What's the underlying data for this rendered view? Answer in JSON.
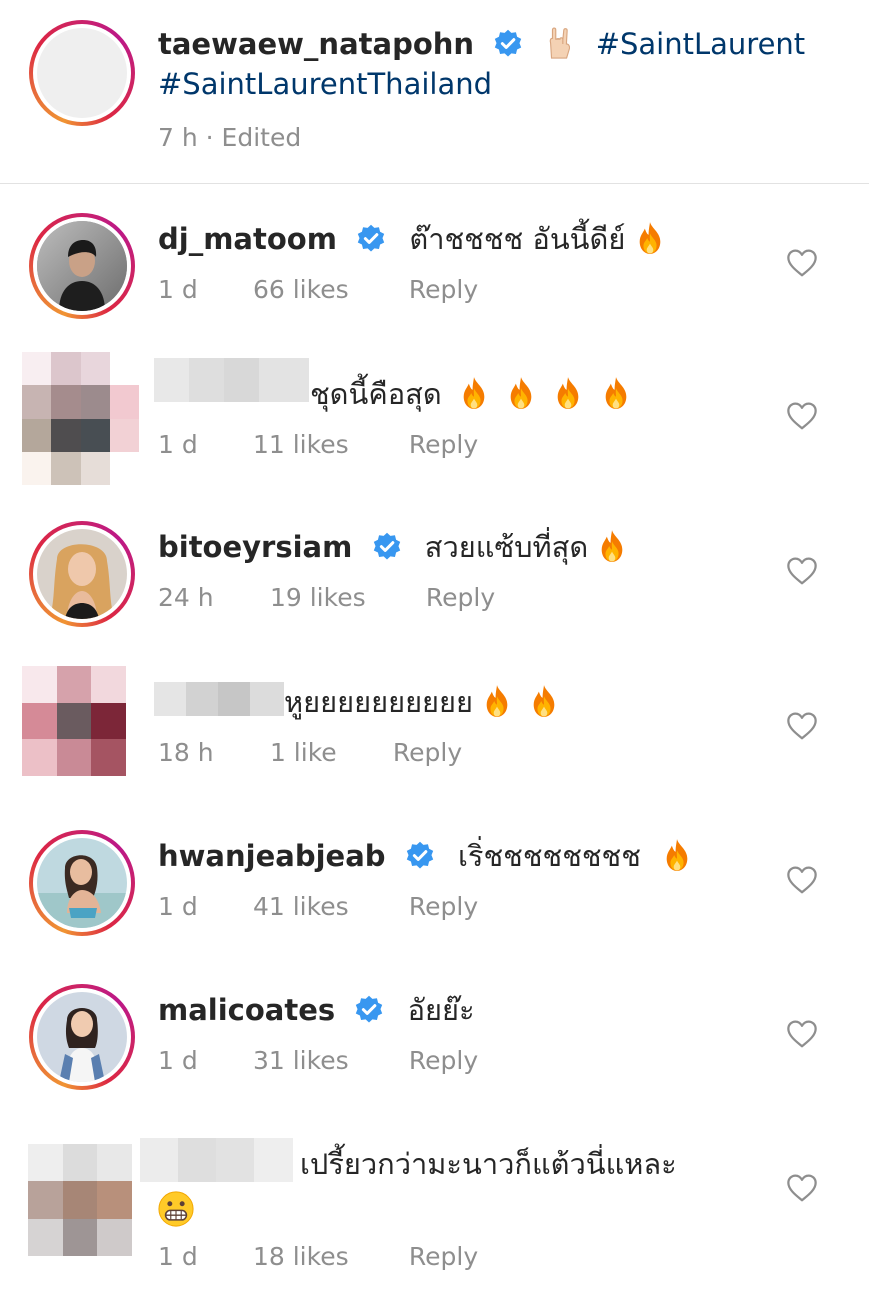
{
  "caption": {
    "username": "taewaew_natapohn",
    "hashtag_1": "#SaintLaurent",
    "hashtag_2": "#SaintLaurentThailand",
    "meta": "7 h · Edited"
  },
  "comments": [
    {
      "username": "dj_matoom",
      "text": "ต๊าชชชช อันนี้ดีย์",
      "time": "1 d",
      "likes": "66 likes",
      "reply": "Reply"
    },
    {
      "username": "",
      "text": "ชุดนี้คือสุด",
      "time": "1 d",
      "likes": "11 likes",
      "reply": "Reply"
    },
    {
      "username": "bitoeyrsiam",
      "text": "สวยแซ้บที่สุด",
      "time": "24 h",
      "likes": "19 likes",
      "reply": "Reply"
    },
    {
      "username": "",
      "text": "หูยยยยยยยยยย",
      "time": "18 h",
      "likes": "1 like",
      "reply": "Reply"
    },
    {
      "username": "hwanjeabjeab",
      "text": "เริ่ชชชชชชชช",
      "time": "1 d",
      "likes": "41 likes",
      "reply": "Reply"
    },
    {
      "username": "malicoates",
      "text": "อัยย๊ะ",
      "time": "1 d",
      "likes": "31 likes",
      "reply": "Reply"
    },
    {
      "username": "",
      "text": "เปรี้ยวกว่ามะนาวก็แต้วนี่แหละ",
      "time": "1 d",
      "likes": "18 likes",
      "reply": "Reply"
    }
  ],
  "icons": {
    "verified": "verified-badge-icon",
    "heart": "heart-outline-icon",
    "fire": "fire-emoji-icon",
    "rock_hand": "rock-hand-emoji-icon",
    "grimace": "grimacing-face-emoji-icon"
  },
  "colors": {
    "verified_blue": "#3897f0",
    "hashtag": "#00376b",
    "meta_gray": "#8e8e8e",
    "text": "#262626"
  }
}
